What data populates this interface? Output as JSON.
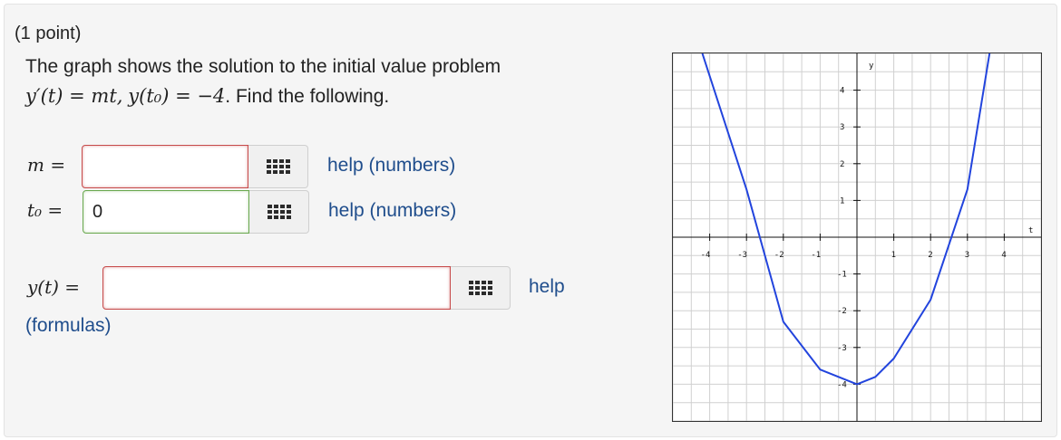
{
  "problem": {
    "points": "(1 point)",
    "intro": "The graph shows the solution to the initial value problem",
    "equation_lhs": "y′(t) = mt,",
    "equation_ic": "y(t₀) = −4",
    "equation_tail": ". Find the following."
  },
  "answers": {
    "m": {
      "label": "m =",
      "value": "",
      "palette_icon": "keypad-grid-icon",
      "help": "help (numbers)"
    },
    "t0": {
      "label": "t₀ =",
      "value": "0",
      "palette_icon": "keypad-grid-icon",
      "help": "help (numbers)"
    },
    "y": {
      "label": "y(t) =",
      "value": "",
      "palette_icon": "keypad-grid-icon",
      "help": "help",
      "help2": "(formulas)"
    }
  },
  "colors": {
    "curve": "#2244dd",
    "incorrect": "#c74b4b",
    "correct": "#6aa84f",
    "link": "#1f4d8c"
  },
  "chart_data": {
    "type": "line",
    "xlabel": "t",
    "ylabel": "y",
    "xlim": [
      -5,
      5
    ],
    "ylim": [
      -5,
      5
    ],
    "x_ticks": [
      "-4",
      "-3",
      "-2",
      "-1",
      "1",
      "2",
      "3",
      "4"
    ],
    "y_ticks": [
      "4",
      "3",
      "2",
      "1",
      "-1",
      "-2",
      "-3",
      "-4"
    ],
    "grid": true,
    "series": [
      {
        "x": [
          -4.2,
          -3,
          -2,
          -1,
          0,
          0.5,
          1,
          2,
          3,
          3.6
        ],
        "y": [
          5.0,
          1.3,
          -2.3,
          -3.6,
          -4,
          -3.8,
          -3.3,
          -1.7,
          1.3,
          5.0
        ]
      }
    ]
  }
}
